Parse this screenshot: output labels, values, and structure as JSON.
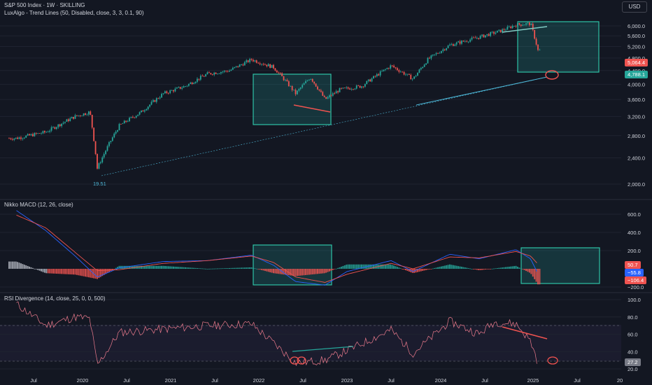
{
  "header": {
    "title": "S&P 500 Index · 1W · SKILLING",
    "indicator": "LuxAlgo - Trend Lines (50, Disabled, close, 3, 3, 0.1, 90)",
    "currency_button": "USD"
  },
  "panes": {
    "macd_title": "Nikko MACD (12, 26, close)",
    "rsi_title": "RSI Divergence (14, close, 25, 0, 0, 500)"
  },
  "colors": {
    "background": "#131722",
    "up_candle": "#26a69a",
    "down_candle": "#ef5350",
    "box_stroke": "#2ec4a6",
    "box_fill": "rgba(38,166,154,0.22)",
    "trendline": "#4db6d6",
    "macd_line": "#2962ff",
    "signal_line": "#ef5350",
    "rsi_line": "#ef7c8e",
    "text": "#d1d4dc",
    "grid": "#1f2330"
  },
  "tags": {
    "price_last": "5,064.4",
    "price_level": "4,788.1",
    "macd_signal": "50.7",
    "macd_value": "−55.8",
    "macd_hist": "−106.4",
    "rsi_value": "27.2"
  },
  "chart_data": [
    {
      "type": "candlestick",
      "title": "S&P 500 Index · 1W · SKILLING",
      "y_ticks": [
        "6,000.0",
        "5,600.0",
        "5,200.0",
        "4,800.0",
        "4,400.0",
        "4,000.0",
        "3,600.0",
        "3,200.0",
        "2,800.0",
        "2,400.0",
        "2,000.0"
      ],
      "x_ticks": [
        "Jul",
        "2020",
        "Jul",
        "2021",
        "Jul",
        "2022",
        "Jul",
        "2023",
        "Jul",
        "2024",
        "Jul",
        "2025",
        "Jul",
        "20"
      ],
      "ylim": [
        1800,
        6200
      ],
      "series": [
        {
          "name": "close",
          "x": [
            "2019-04",
            "2019-08",
            "2019-12",
            "2020-02",
            "2020-03",
            "2020-06",
            "2020-09",
            "2020-12",
            "2021-03",
            "2021-06",
            "2021-09",
            "2021-12",
            "2022-03",
            "2022-06",
            "2022-08",
            "2022-10",
            "2022-12",
            "2023-03",
            "2023-07",
            "2023-10",
            "2023-12",
            "2024-03",
            "2024-07",
            "2024-10",
            "2024-12",
            "2025-02",
            "2025-03"
          ],
          "values": [
            2750,
            2870,
            3200,
            3300,
            2230,
            3000,
            3300,
            3750,
            3950,
            4300,
            4400,
            4750,
            4500,
            3750,
            4200,
            3600,
            3850,
            3950,
            4550,
            4150,
            4750,
            5250,
            5550,
            5800,
            6050,
            6100,
            5060
          ]
        }
      ],
      "annotations": [
        "19.51"
      ]
    },
    {
      "type": "line",
      "title": "Nikko MACD (12, 26, close)",
      "y_ticks": [
        "600.0",
        "400.0",
        "200.0",
        "−200.0"
      ],
      "ylim": [
        -250,
        650
      ],
      "series": [
        {
          "name": "macd",
          "x": [
            "2019-04",
            "2019-08",
            "2019-12",
            "2020-03",
            "2020-06",
            "2020-12",
            "2021-06",
            "2021-12",
            "2022-03",
            "2022-06",
            "2022-10",
            "2023-01",
            "2023-07",
            "2023-10",
            "2024-03",
            "2024-07",
            "2024-12",
            "2025-02",
            "2025-03"
          ],
          "values": [
            640,
            420,
            140,
            -90,
            10,
            80,
            90,
            150,
            40,
            -140,
            -180,
            -30,
            90,
            -30,
            160,
            110,
            210,
            110,
            -56
          ]
        },
        {
          "name": "signal",
          "x": [
            "2019-04",
            "2019-08",
            "2019-12",
            "2020-03",
            "2020-06",
            "2020-12",
            "2021-06",
            "2021-12",
            "2022-03",
            "2022-06",
            "2022-10",
            "2023-01",
            "2023-07",
            "2023-10",
            "2024-03",
            "2024-07",
            "2024-12",
            "2025-02",
            "2025-03"
          ],
          "values": [
            590,
            450,
            180,
            -20,
            -10,
            60,
            90,
            140,
            70,
            -90,
            -150,
            -60,
            60,
            0,
            130,
            120,
            190,
            140,
            51
          ]
        }
      ]
    },
    {
      "type": "line",
      "title": "RSI Divergence (14, close, 25, 0, 0, 500)",
      "y_ticks": [
        "100.0",
        "80.0",
        "60.0",
        "40.0",
        "20.0"
      ],
      "ylim": [
        20,
        100
      ],
      "series": [
        {
          "name": "rsi",
          "x": [
            "2019-04",
            "2019-08",
            "2019-12",
            "2020-02",
            "2020-03",
            "2020-06",
            "2020-12",
            "2021-06",
            "2021-12",
            "2022-03",
            "2022-06",
            "2022-10",
            "2023-02",
            "2023-07",
            "2023-10",
            "2024-03",
            "2024-07",
            "2024-09",
            "2024-12",
            "2025-02",
            "2025-03"
          ],
          "values": [
            95,
            70,
            80,
            78,
            24,
            62,
            66,
            70,
            72,
            50,
            27,
            30,
            45,
            65,
            38,
            75,
            60,
            74,
            72,
            52,
            27
          ]
        }
      ]
    }
  ]
}
